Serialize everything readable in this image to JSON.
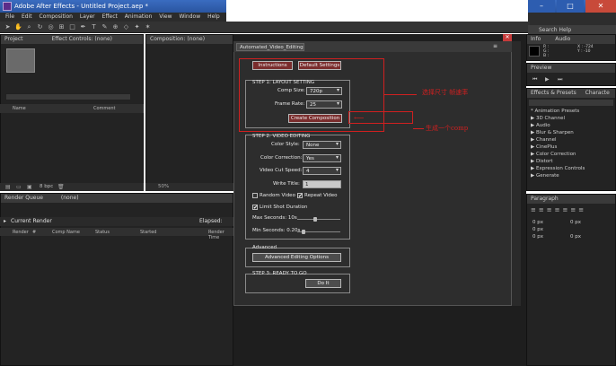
{
  "window": {
    "title": "Adobe After Effects - Untitled Project.aep *"
  },
  "menu": {
    "items": [
      "File",
      "Edit",
      "Composition",
      "Layer",
      "Effect",
      "Animation",
      "View",
      "Window",
      "Help"
    ]
  },
  "toolbar": {
    "search_placeholder": "Search Help"
  },
  "project_panel": {
    "tab_project": "Project",
    "tab_effect_controls": "Effect Controls: (none)",
    "col_name": "Name",
    "col_comment": "Comment",
    "bpc": "8 bpc"
  },
  "composition_panel": {
    "tab": "Composition: (none)",
    "zoom": "50%"
  },
  "render_queue": {
    "tab": "Render Queue",
    "tab2": "(none)",
    "current_render": "Current Render",
    "elapsed": "Elapsed:",
    "cols": [
      "Render",
      "#",
      "Comp Name",
      "Status",
      "Started",
      "Render Time"
    ]
  },
  "right_panels": {
    "info_tab": "Info",
    "audio_tab": "Audio",
    "info_values": [
      "R :",
      "G :",
      "B :",
      "A : 0",
      "X : -724",
      "Y : -10"
    ],
    "preview_tab": "Preview",
    "effects_tab": "Effects & Presets",
    "character_tab": "Characte",
    "effects_list": [
      "* Animation Presets",
      "▶ 3D Channel",
      "▶ Audio",
      "▶ Blur & Sharpen",
      "▶ Channel",
      "▶ CinePlus",
      "▶ Color Correction",
      "▶ Distort",
      "▶ Expression Controls",
      "▶ Generate"
    ],
    "paragraph_tab": "Paragraph",
    "para_values": [
      "0 px",
      "0 px",
      "0 px",
      "0 px",
      "0 px"
    ]
  },
  "dialog": {
    "tab": "Automated_Video_Editing",
    "instructions": "Instructions",
    "default_settings": "Default Settings",
    "step1": "STEP 1: LAYOUT SETTING",
    "comp_size_label": "Comp Size:",
    "comp_size_value": "720p",
    "frame_rate_label": "Frame Rate:",
    "frame_rate_value": "25",
    "create_composition": "Create Composition",
    "step2": "STEP 2: VIDEO EDITING",
    "color_style_label": "Color Style:",
    "color_style_value": "None",
    "color_correction_label": "Color Correction:",
    "color_correction_value": "Yes",
    "video_cut_speed_label": "Video Cut Speed:",
    "video_cut_speed_value": "4",
    "write_title_label": "Write Title:",
    "write_title_value": "1",
    "random_video": "Random Video",
    "repeat_video": "Repeat Video",
    "limit_shot_duration": "Limit Shot Duration",
    "max_seconds": "Max Seconds: 10s",
    "min_seconds": "Min Seconds: 0.20s",
    "advanced": "Advanced",
    "advanced_editing_options": "Advanced Editing Options",
    "step3": "STEP 3: READY TO GO",
    "do_it": "Do It",
    "repeat_checked": true,
    "limit_checked": true,
    "random_checked": false
  },
  "annotations": {
    "note1": "选择尺寸 帧速率",
    "note2": "生成一个comp"
  },
  "colors": {
    "accent_red": "#d02020",
    "button_red": "#7a2d2d",
    "title_blue": "#2a55a0"
  }
}
